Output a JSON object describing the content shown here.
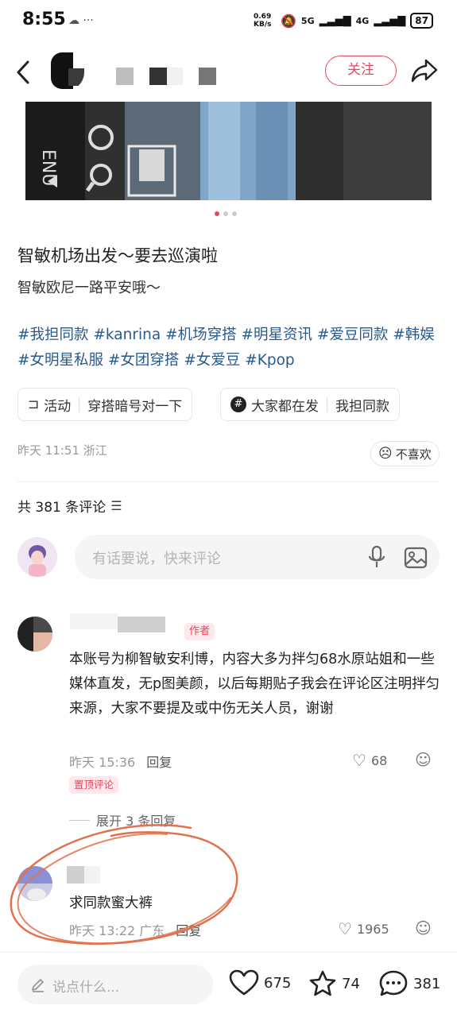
{
  "status": {
    "time": "8:55",
    "speed": "0.69 KB/s",
    "net1": "5G",
    "net2": "4G",
    "battery": "87"
  },
  "nav": {
    "follow_label": "关注"
  },
  "post": {
    "title": "智敏机场出发～要去巡演啦",
    "description": "智敏欧尼一路平安哦～",
    "tags": [
      "#我担同款",
      "#kanrina",
      "#机场穿搭",
      "#明星资讯",
      "#爱豆同款",
      "#韩娱",
      "#女明星私服",
      "#女团穿搭",
      "#女爱豆",
      "#Kpop"
    ],
    "chips": [
      {
        "label": "活动",
        "value": "穿搭暗号对一下"
      },
      {
        "label": "大家都在发",
        "value": "我担同款"
      }
    ],
    "time_location": "昨天 11:51 浙江",
    "dislike_label": "不喜欢"
  },
  "comments_header": {
    "count_label": "共 381 条评论",
    "input_placeholder": "有话要说，快来评论"
  },
  "comments": [
    {
      "badge": "作者",
      "text": "本账号为柳智敏安利博，内容大多为拌匀68水原站姐和一些媒体直发，无p图美颜，以后每期贴子我会在评论区注明拌匀来源，大家不要提及或中伤无关人员，谢谢",
      "time": "昨天 15:36",
      "reply": "回复",
      "likes": "68",
      "pinned": "置顶评论",
      "expand": "展开 3 条回复"
    },
    {
      "text": "求同款蜜大裤",
      "time": "昨天 13:22 广东",
      "reply": "回复",
      "likes": "1965"
    }
  ],
  "bottom": {
    "say_placeholder": "说点什么...",
    "likes": "675",
    "stars": "74",
    "comments": "381"
  },
  "colors": {
    "accent": "#e8475b",
    "tag": "#2a5a8c",
    "scribble": "#e0724f"
  }
}
